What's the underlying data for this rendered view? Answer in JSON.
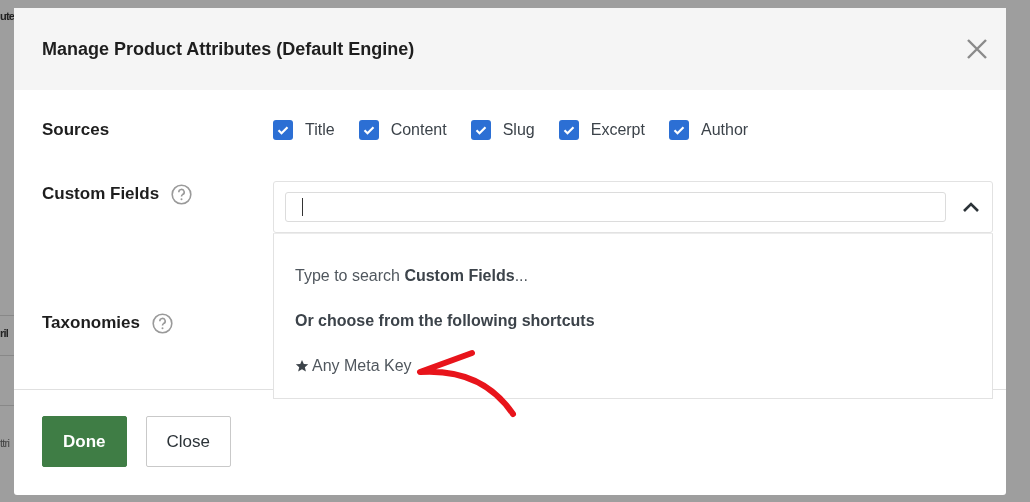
{
  "background_fragments": [
    "ute",
    "ril",
    "ttri"
  ],
  "dialog": {
    "title": "Manage Product Attributes (Default Engine)",
    "sources": {
      "label": "Sources",
      "options": [
        {
          "label": "Title",
          "checked": true
        },
        {
          "label": "Content",
          "checked": true
        },
        {
          "label": "Slug",
          "checked": true
        },
        {
          "label": "Excerpt",
          "checked": true
        },
        {
          "label": "Author",
          "checked": true
        }
      ]
    },
    "custom_fields": {
      "label": "Custom Fields",
      "expanded": true,
      "dropdown": {
        "hint": "Type to search **Custom Fields**...",
        "heading": "Or choose from the following shortcuts",
        "shortcuts": [
          {
            "label": "Any Meta Key"
          }
        ]
      }
    },
    "taxonomies": {
      "label": "Taxonomies"
    },
    "buttons": [
      {
        "label": "Done",
        "kind": "primary"
      },
      {
        "label": "Close",
        "kind": "secondary"
      }
    ]
  }
}
